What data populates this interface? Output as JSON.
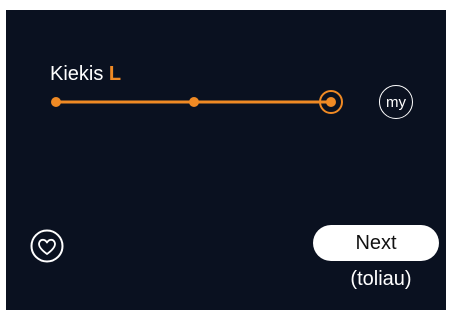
{
  "setting": {
    "label": "Kiekis",
    "value": "L",
    "accent_color": "#f08a24",
    "steps": 3,
    "selected_step": 3
  },
  "my_button": {
    "label": "my"
  },
  "favorite": {
    "icon": "heart-icon"
  },
  "next_button": {
    "label": "Next",
    "sublabel": "(toliau)"
  },
  "colors": {
    "background": "#0a1120",
    "accent": "#f08a24",
    "text": "#ffffff"
  }
}
